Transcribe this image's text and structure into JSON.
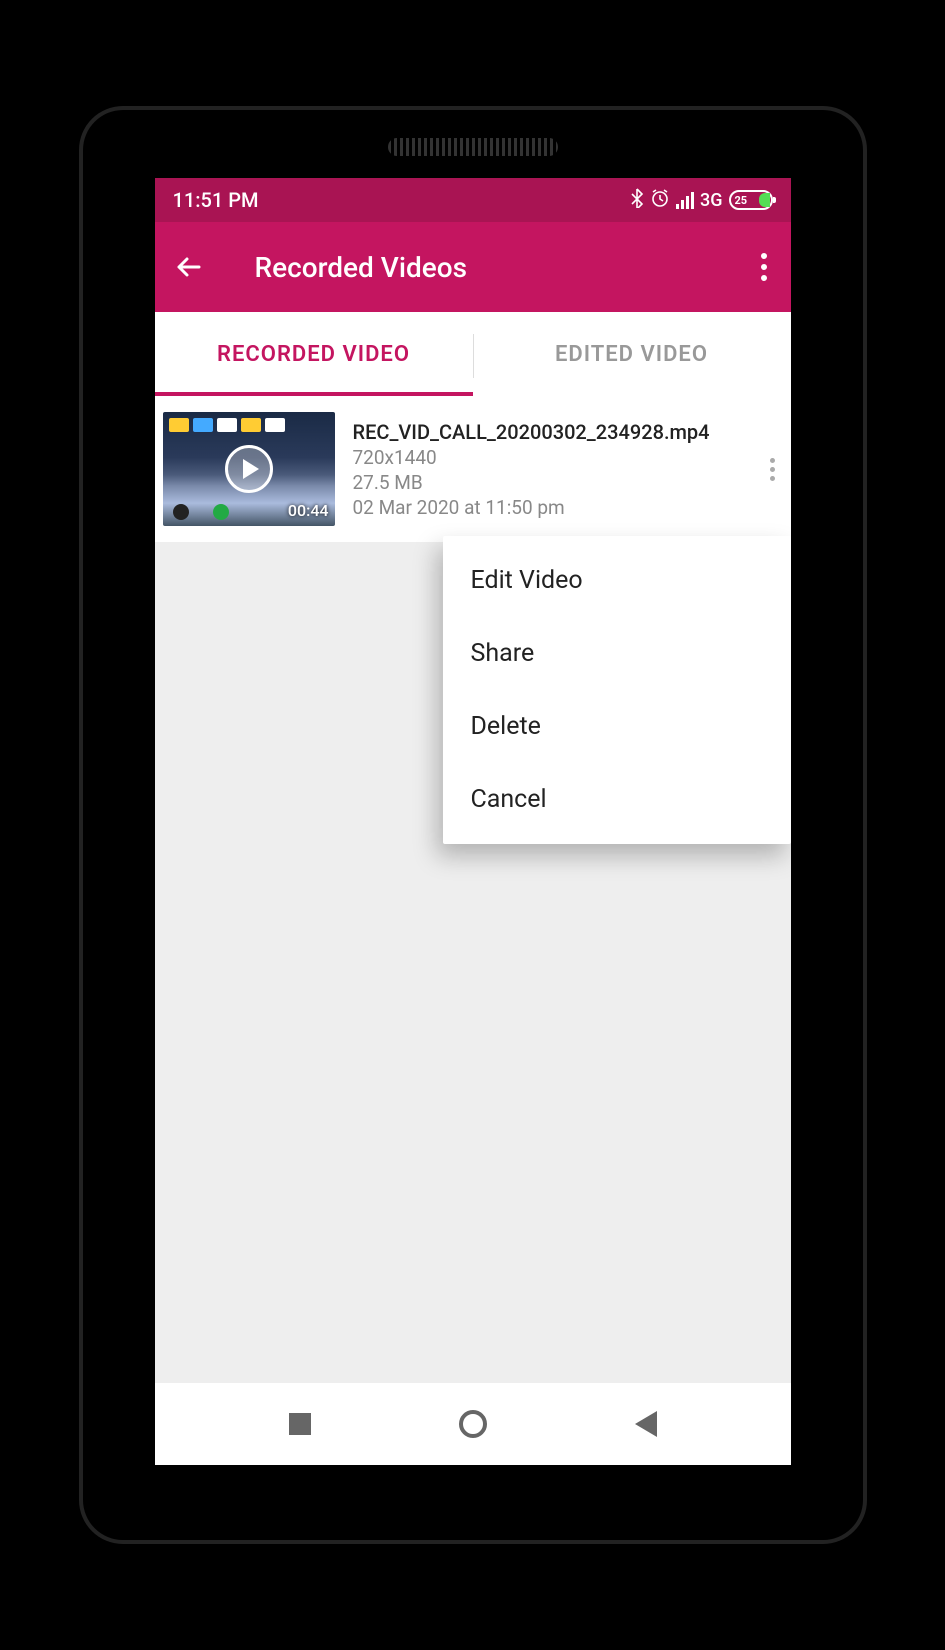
{
  "status_bar": {
    "time": "11:51 PM",
    "network": "3G",
    "battery_percent": "25"
  },
  "app_bar": {
    "title": "Recorded Videos"
  },
  "tabs": {
    "recorded": "RECORDED VIDEO",
    "edited": "EDITED VIDEO"
  },
  "video": {
    "filename": "REC_VID_CALL_20200302_234928.mp4",
    "resolution": "720x1440",
    "size": "27.5 MB",
    "datetime": "02 Mar 2020 at 11:50 pm",
    "duration": "00:44"
  },
  "popup": {
    "edit": "Edit Video",
    "share": "Share",
    "delete": "Delete",
    "cancel": "Cancel"
  }
}
